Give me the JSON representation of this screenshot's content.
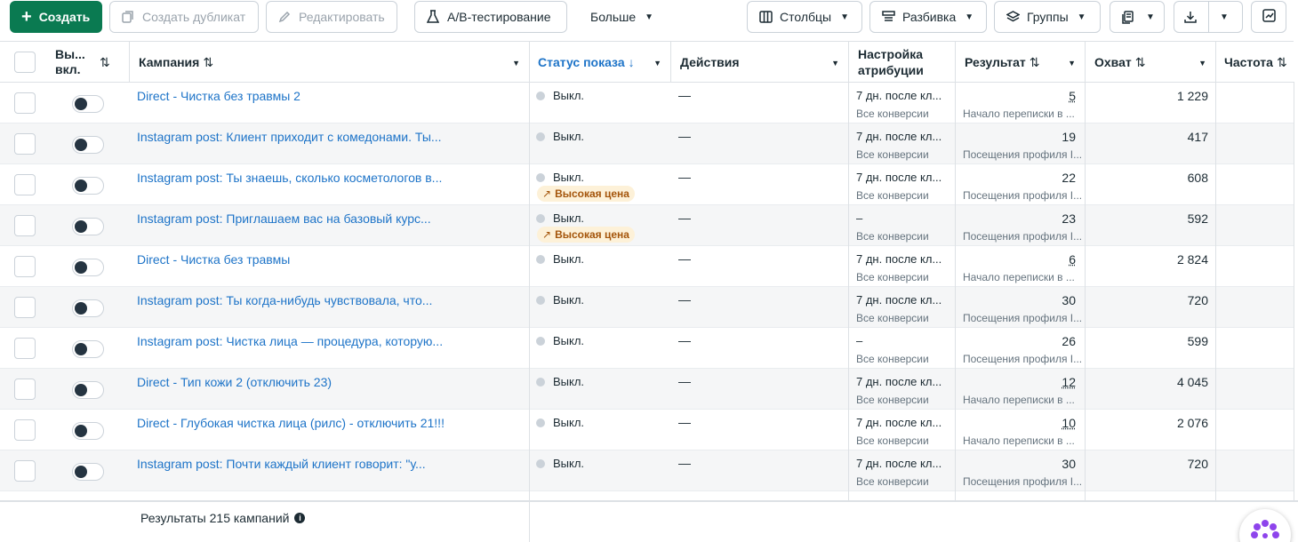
{
  "toolbar": {
    "create": "Создать",
    "duplicate": "Создать дубликат",
    "edit": "Редактировать",
    "ab_test": "A/B-тестирование",
    "more": "Больше",
    "columns": "Столбцы",
    "breakdown": "Разбивка",
    "groups": "Группы"
  },
  "headers": {
    "onoff": "Вы... вкл.",
    "campaign": "Кампания",
    "status": "Статус показа",
    "actions": "Действия",
    "attribution": "Настройка атрибуции",
    "result": "Результат",
    "reach": "Охват",
    "frequency": "Частота"
  },
  "rows": [
    {
      "name": "Direct - Чистка без травмы 2",
      "status": "Выкл.",
      "badge": "",
      "actions": "—",
      "attr": "7 дн. после кл...",
      "attr_sub": "Все конверсии",
      "result": "5",
      "result_sub": "Начало переписки в ...",
      "reach": "1 229"
    },
    {
      "name": "Instagram post: Клиент приходит с комедонами. Ты...",
      "status": "Выкл.",
      "badge": "",
      "actions": "—",
      "attr": "7 дн. после кл...",
      "attr_sub": "Все конверсии",
      "result": "19",
      "result_sub": "Посещения профиля I...",
      "reach": "417"
    },
    {
      "name": "Instagram post: Ты знаешь, сколько косметологов в...",
      "status": "Выкл.",
      "badge": "Высокая цена",
      "actions": "—",
      "attr": "7 дн. после кл...",
      "attr_sub": "Все конверсии",
      "result": "22",
      "result_sub": "Посещения профиля I...",
      "reach": "608"
    },
    {
      "name": "Instagram post: Приглашаем вас на базовый курс...",
      "status": "Выкл.",
      "badge": "Высокая цена",
      "actions": "—",
      "attr": "–",
      "attr_sub": "Все конверсии",
      "result": "23",
      "result_sub": "Посещения профиля I...",
      "reach": "592"
    },
    {
      "name": "Direct - Чистка без травмы",
      "status": "Выкл.",
      "badge": "",
      "actions": "—",
      "attr": "7 дн. после кл...",
      "attr_sub": "Все конверсии",
      "result": "6",
      "result_sub": "Начало переписки в ...",
      "reach": "2 824"
    },
    {
      "name": "Instagram post: Ты когда-нибудь чувствовала, что...",
      "status": "Выкл.",
      "badge": "",
      "actions": "—",
      "attr": "7 дн. после кл...",
      "attr_sub": "Все конверсии",
      "result": "30",
      "result_sub": "Посещения профиля I...",
      "reach": "720"
    },
    {
      "name": "Instagram post: Чистка лица — процедура, которую...",
      "status": "Выкл.",
      "badge": "",
      "actions": "—",
      "attr": "–",
      "attr_sub": "Все конверсии",
      "result": "26",
      "result_sub": "Посещения профиля I...",
      "reach": "599"
    },
    {
      "name": "Direct - Тип кожи 2 (отключить 23)",
      "status": "Выкл.",
      "badge": "",
      "actions": "—",
      "attr": "7 дн. после кл...",
      "attr_sub": "Все конверсии",
      "result": "12",
      "result_sub": "Начало переписки в ...",
      "reach": "4 045"
    },
    {
      "name": "Direct - Глубокая чистка лица (рилс) - отключить 21!!!",
      "status": "Выкл.",
      "badge": "",
      "actions": "—",
      "attr": "7 дн. после кл...",
      "attr_sub": "Все конверсии",
      "result": "10",
      "result_sub": "Начало переписки в ...",
      "reach": "2 076"
    },
    {
      "name": "Instagram post: Почти каждый клиент говорит: \"у...",
      "status": "Выкл.",
      "badge": "",
      "actions": "—",
      "attr": "7 дн. после кл...",
      "attr_sub": "Все конверсии",
      "result": "30",
      "result_sub": "Посещения профиля I...",
      "reach": "720"
    }
  ],
  "footer": {
    "summary": "Результаты 215 кампаний"
  },
  "colors": {
    "primary_green": "#0a7a51",
    "link_blue": "#1e74c8",
    "badge_bg": "#fdf1d8",
    "badge_text": "#a4550b"
  },
  "icons": [
    "plus-icon",
    "duplicate-icon",
    "pencil-icon",
    "flask-icon",
    "columns-icon",
    "breakdown-icon",
    "layers-icon",
    "report-icon",
    "download-icon",
    "chart-icon",
    "info-icon",
    "trend-up-icon"
  ]
}
